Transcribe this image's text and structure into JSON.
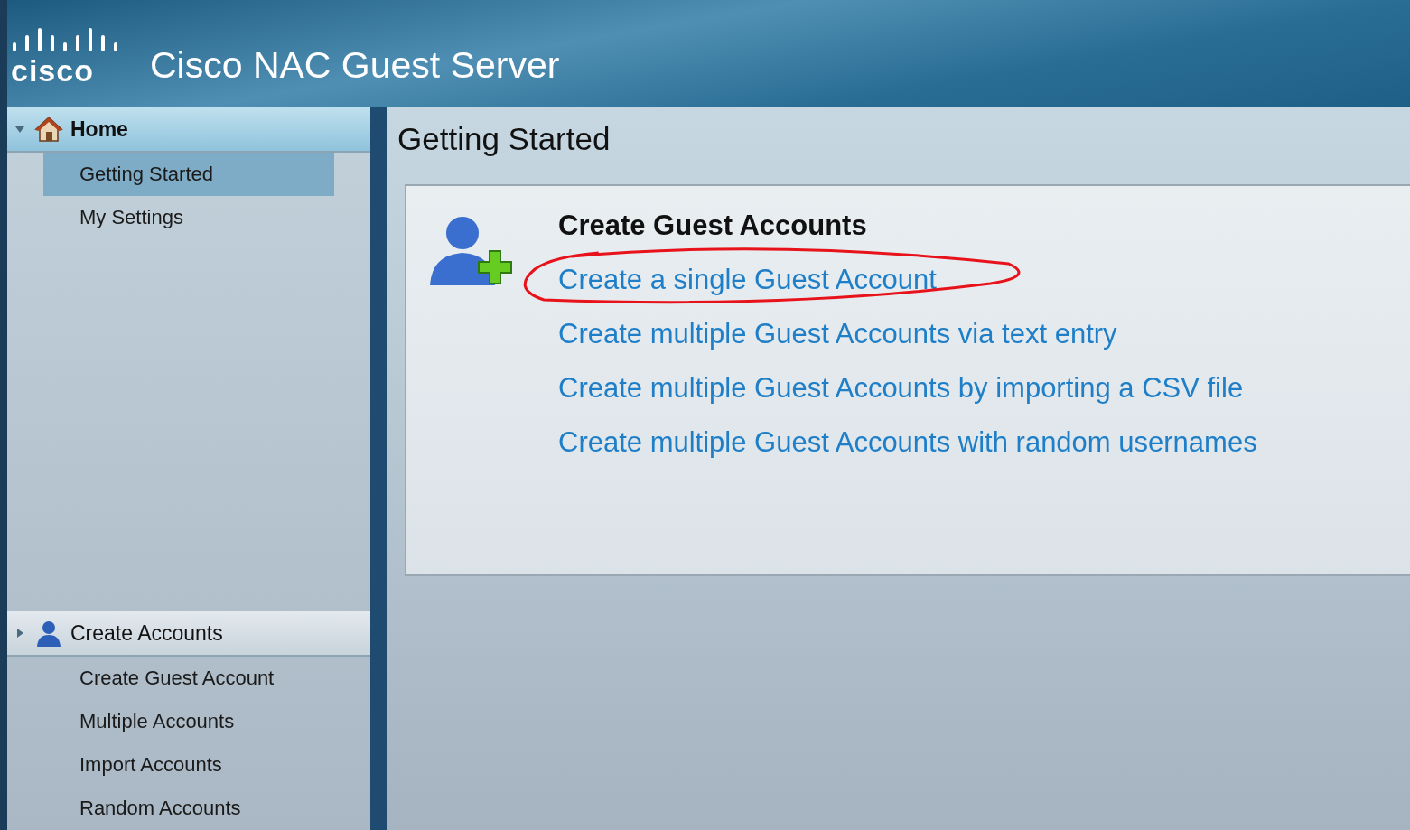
{
  "header": {
    "logo_text": "cisco",
    "title": "Cisco NAC Guest Server"
  },
  "sidebar": {
    "groups": [
      {
        "label": "Home",
        "kind": "home",
        "expanded": true,
        "items": [
          {
            "label": "Getting Started",
            "selected": true
          },
          {
            "label": "My Settings",
            "selected": false
          }
        ]
      },
      {
        "label": "Create Accounts",
        "kind": "user",
        "expanded": false,
        "items": [
          {
            "label": "Create Guest Account",
            "selected": false
          },
          {
            "label": "Multiple Accounts",
            "selected": false
          },
          {
            "label": "Import Accounts",
            "selected": false
          },
          {
            "label": "Random Accounts",
            "selected": false
          }
        ]
      }
    ]
  },
  "main": {
    "title": "Getting Started",
    "card": {
      "heading": "Create Guest Accounts",
      "links": [
        {
          "label": "Create a single Guest Account",
          "circled": true
        },
        {
          "label": "Create multiple Guest Accounts via text entry",
          "circled": false
        },
        {
          "label": "Create multiple Guest Accounts by importing a CSV file",
          "circled": false
        },
        {
          "label": "Create multiple Guest Accounts with random usernames",
          "circled": false
        }
      ]
    }
  }
}
